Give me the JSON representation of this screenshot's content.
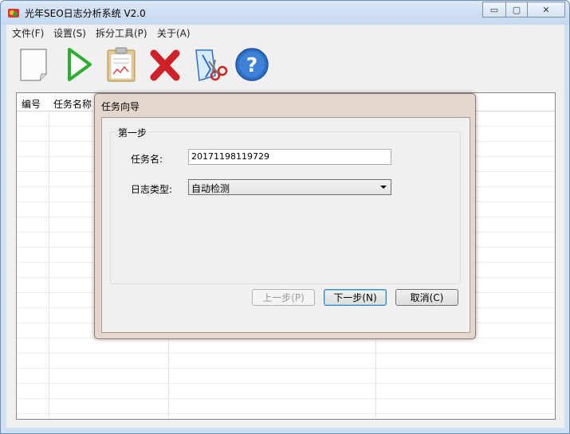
{
  "window": {
    "title": "光年SEO日志分析系统 V2.0",
    "controls": {
      "minimize": "▭",
      "maximize": "▢",
      "close": "✕"
    }
  },
  "menu": [
    {
      "label": "文件(F)"
    },
    {
      "label": "设置(S)"
    },
    {
      "label": "拆分工具(P)"
    },
    {
      "label": "关于(A)"
    }
  ],
  "toolbar": {
    "icons": [
      "new-document-icon",
      "play-icon",
      "report-clipboard-icon",
      "delete-icon",
      "split-tool-icon",
      "help-icon"
    ],
    "colors": {
      "play": "#2dae2d",
      "delete": "#d0202a",
      "help": "#2f6fc4"
    }
  },
  "grid": {
    "columns": [
      "编号",
      "任务名称"
    ]
  },
  "dialog": {
    "title": "任务向导",
    "step_group": "第一步",
    "task_name_label": "任务名:",
    "task_name_value": "20171198119729",
    "log_type_label": "日志类型:",
    "log_type_value": "自动检测",
    "prev_button": "上一步(P)",
    "next_button": "下一步(N)",
    "cancel_button": "取消(C)"
  }
}
